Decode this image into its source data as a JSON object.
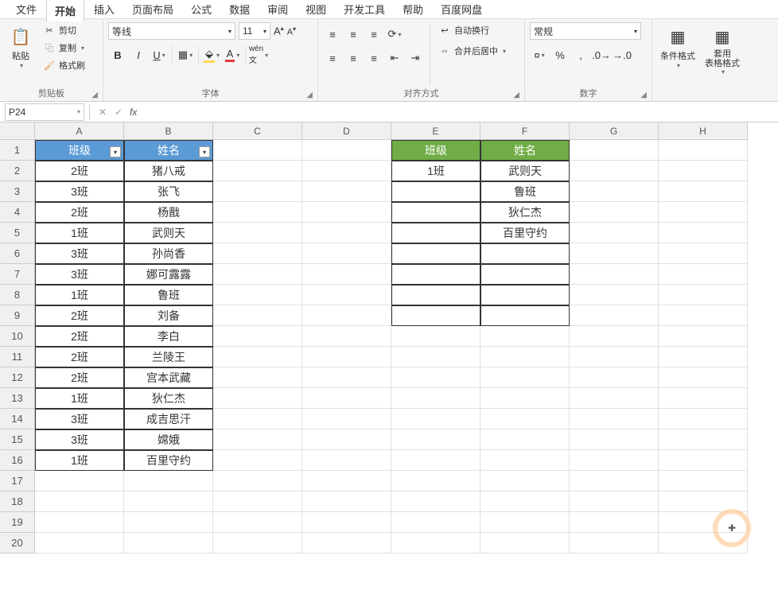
{
  "menu": {
    "items": [
      "文件",
      "开始",
      "插入",
      "页面布局",
      "公式",
      "数据",
      "审阅",
      "视图",
      "开发工具",
      "帮助",
      "百度网盘"
    ],
    "active_index": 1
  },
  "ribbon": {
    "clipboard": {
      "paste": "粘贴",
      "cut": "剪切",
      "copy": "复制",
      "format_painter": "格式刷",
      "label": "剪贴板"
    },
    "font": {
      "name": "等线",
      "size": "11",
      "label": "字体"
    },
    "align": {
      "wrap": "自动换行",
      "merge": "合并后居中",
      "label": "对齐方式"
    },
    "number": {
      "format": "常规",
      "label": "数字"
    },
    "styles": {
      "cond": "条件格式",
      "table": "套用\n表格格式"
    }
  },
  "formula": {
    "name_box": "P24",
    "value": ""
  },
  "cols": [
    "A",
    "B",
    "C",
    "D",
    "E",
    "F",
    "G",
    "H"
  ],
  "rows": 20,
  "tableAB": {
    "headers": [
      "班级",
      "姓名"
    ],
    "rows": [
      [
        "2班",
        "猪八戒"
      ],
      [
        "3班",
        "张飞"
      ],
      [
        "2班",
        "杨戬"
      ],
      [
        "1班",
        "武则天"
      ],
      [
        "3班",
        "孙尚香"
      ],
      [
        "3班",
        "娜可露露"
      ],
      [
        "1班",
        "鲁班"
      ],
      [
        "2班",
        "刘备"
      ],
      [
        "2班",
        "李白"
      ],
      [
        "2班",
        "兰陵王"
      ],
      [
        "2班",
        "宫本武藏"
      ],
      [
        "1班",
        "狄仁杰"
      ],
      [
        "3班",
        "成吉思汗"
      ],
      [
        "3班",
        "嫦娥"
      ],
      [
        "1班",
        "百里守约"
      ]
    ]
  },
  "tableEF": {
    "headers": [
      "班级",
      "姓名"
    ],
    "rows": [
      [
        "1班",
        "武则天"
      ],
      [
        "",
        "鲁班"
      ],
      [
        "",
        "狄仁杰"
      ],
      [
        "",
        "百里守约"
      ],
      [
        "",
        ""
      ],
      [
        "",
        ""
      ],
      [
        "",
        ""
      ],
      [
        "",
        ""
      ]
    ]
  }
}
